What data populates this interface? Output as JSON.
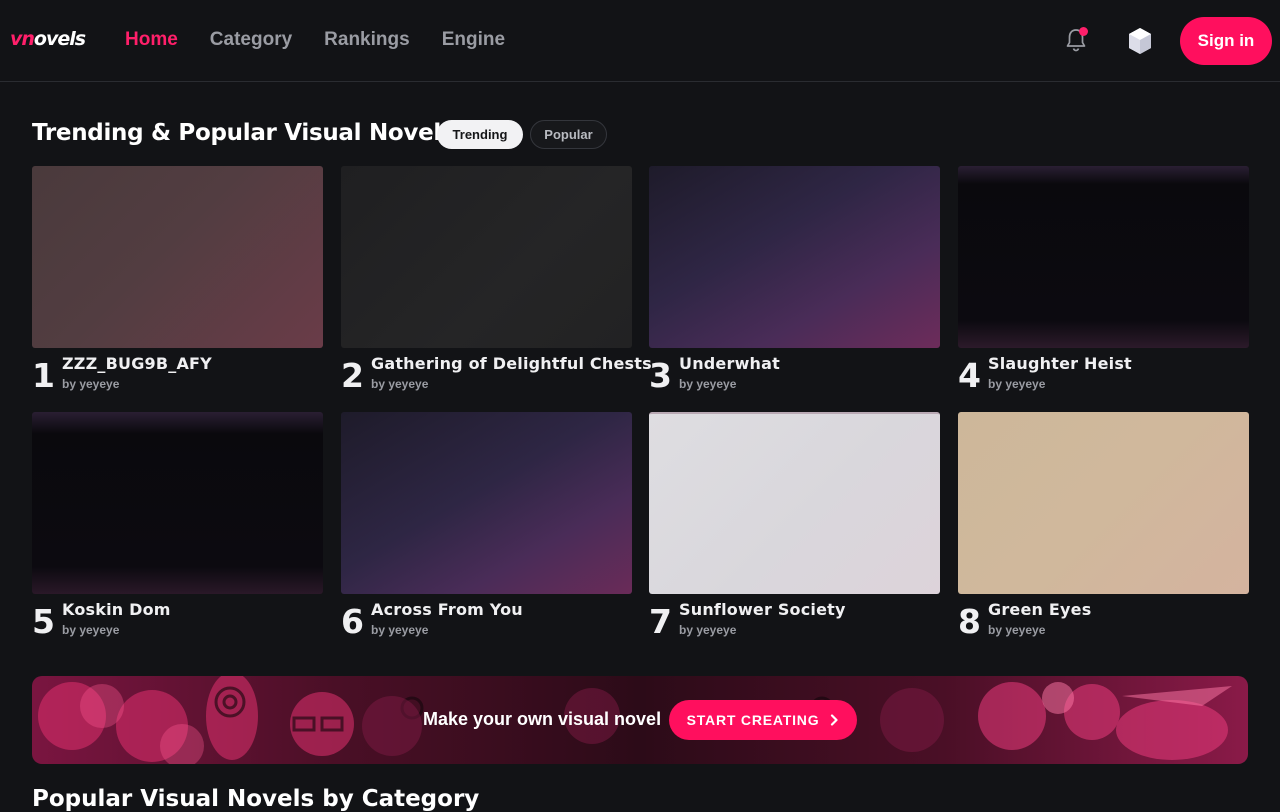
{
  "header": {
    "logo_prefix": "vn",
    "logo_suffix": "ovels",
    "nav": [
      {
        "label": "Home",
        "active": true
      },
      {
        "label": "Category",
        "active": false
      },
      {
        "label": "Rankings",
        "active": false
      },
      {
        "label": "Engine",
        "active": false
      }
    ],
    "sign_in_label": "Sign in",
    "icons": {
      "notifications": "bell-icon",
      "currency": "gem-icon"
    },
    "accent_color": "#ff1f6a"
  },
  "trending": {
    "title": "Trending & Popular Visual Novels",
    "tabs": [
      {
        "label": "Trending",
        "selected": true
      },
      {
        "label": "Popular",
        "selected": false
      }
    ],
    "novels": [
      {
        "rank": "1",
        "title": "ZZZ_BUG9B_AFY",
        "author": "by yeyeye"
      },
      {
        "rank": "2",
        "title": "Gathering of Delightful Chests",
        "author": "by yeyeye"
      },
      {
        "rank": "3",
        "title": "Underwhat",
        "author": "by yeyeye"
      },
      {
        "rank": "4",
        "title": "Slaughter Heist",
        "author": "by yeyeye"
      },
      {
        "rank": "5",
        "title": "Koskin Dom",
        "author": "by yeyeye"
      },
      {
        "rank": "6",
        "title": "Across From You",
        "author": "by yeyeye"
      },
      {
        "rank": "7",
        "title": "Sunflower Society",
        "author": "by yeyeye"
      },
      {
        "rank": "8",
        "title": "Green Eyes",
        "author": "by yeyeye"
      }
    ]
  },
  "banner": {
    "text": "Make your own visual novel",
    "cta_label": "START CREATING",
    "cta_icon": "chevron-right-icon"
  },
  "next_section": {
    "title": "Popular Visual Novels by Category"
  }
}
